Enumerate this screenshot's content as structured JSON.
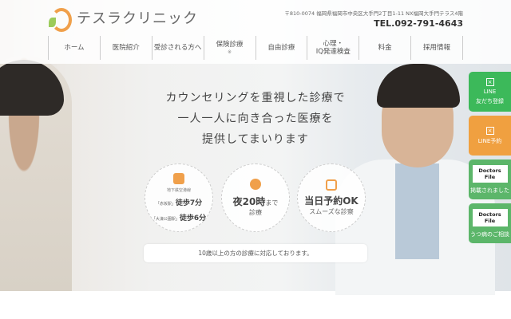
{
  "header": {
    "logo_text": "テスラクリニック",
    "address": "〒810-0074 福岡県福岡市中央区大手門2丁目1-11 NX福岡大手門テラス4階",
    "tel": "TEL.092-791-4643"
  },
  "nav": [
    {
      "label": "ホーム"
    },
    {
      "label": "医院紹介"
    },
    {
      "label": "受診される方へ"
    },
    {
      "label": "保険診療",
      "sub": "※"
    },
    {
      "label": "自由診療"
    },
    {
      "label": "心理・",
      "label2": "IQ発達検査"
    },
    {
      "label": "料金"
    },
    {
      "label": "採用情報"
    }
  ],
  "hero": {
    "catch": [
      "カウンセリングを重視した診療で",
      "一人一人に向き合った医療を",
      "提供してまいります"
    ]
  },
  "features": {
    "access": {
      "line": "地下鉄空港線",
      "station1": "「赤坂駅」",
      "walk1": "徒歩7分",
      "station2": "「大濠公園駅」",
      "walk2": "徒歩6分"
    },
    "night": {
      "big": "夜20時",
      "suffix": "まで",
      "sub": "診療"
    },
    "sameday": {
      "big": "当日予約OK",
      "sub": "スムーズな診察"
    }
  },
  "notice": "10歳以上の方の診療に対応しております。",
  "side": [
    {
      "l1": "LINE",
      "l2": "友だち登録"
    },
    {
      "l1": "LINE予約"
    },
    {
      "logo": "Doctors File",
      "l1": "掲載されました"
    },
    {
      "logo": "Doctors File",
      "l1": "うつ病のご相談"
    }
  ],
  "colors": {
    "accent": "#f0a04b",
    "line_green": "#3cb95a",
    "orange": "#f0a040"
  }
}
